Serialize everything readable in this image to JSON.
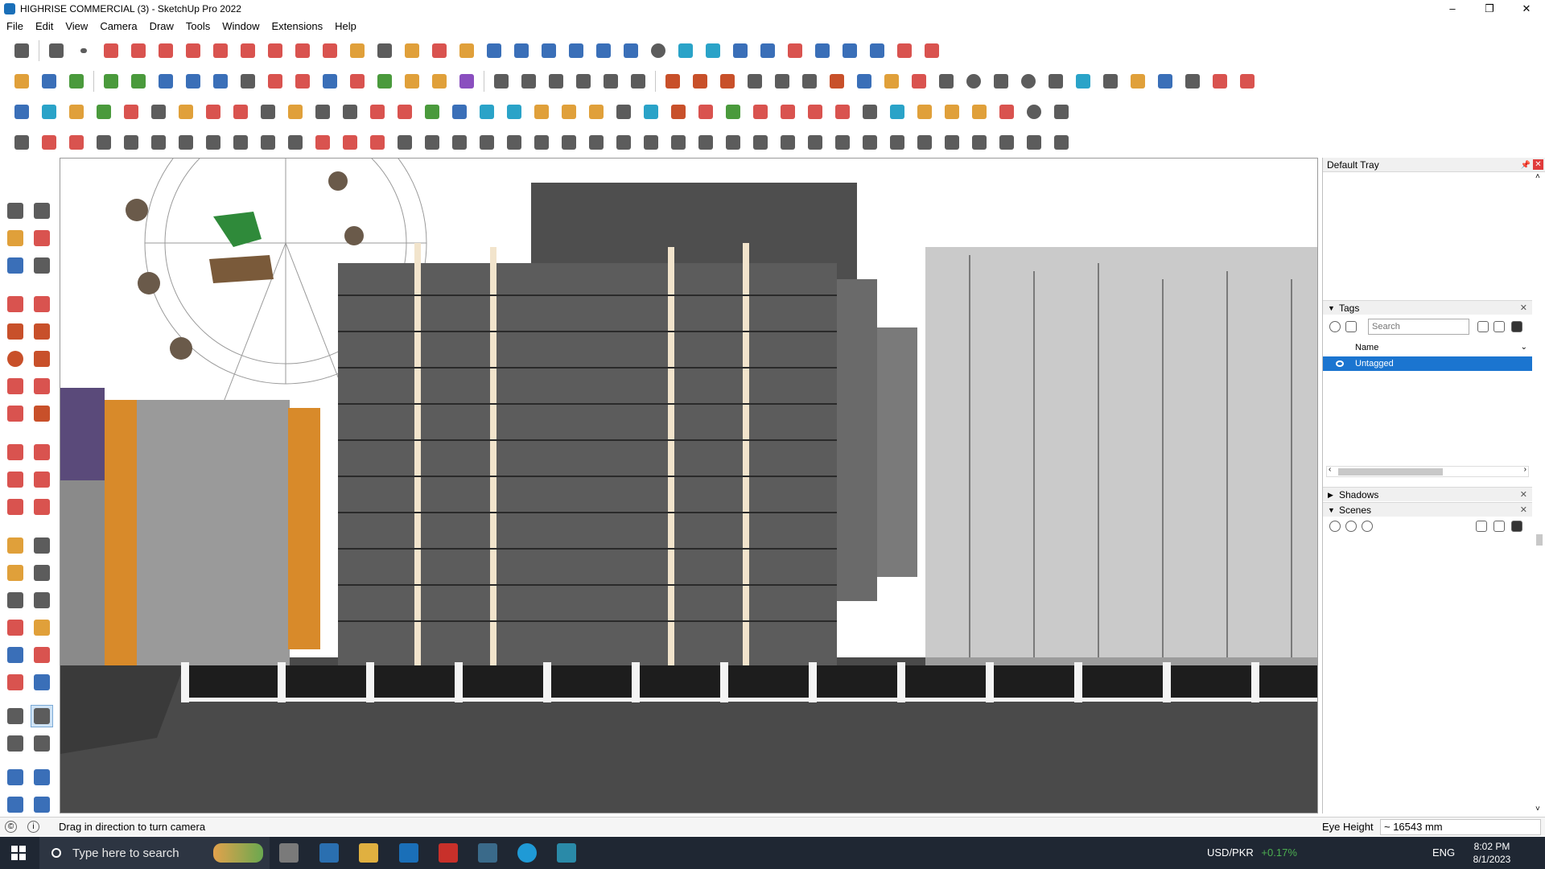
{
  "window": {
    "title": "HIGHRISE COMMERCIAL (3) - SketchUp Pro 2022",
    "buttons": [
      "–",
      "❐",
      "✕"
    ]
  },
  "menu": [
    "File",
    "Edit",
    "View",
    "Camera",
    "Draw",
    "Tools",
    "Window",
    "Extensions",
    "Help"
  ],
  "tray": {
    "title": "Default Tray",
    "tags": {
      "header": "Tags",
      "search_placeholder": "Search",
      "column_name": "Name",
      "rows": [
        "Untagged"
      ]
    },
    "shadows": {
      "header": "Shadows"
    },
    "scenes": {
      "header": "Scenes"
    }
  },
  "statusbar": {
    "hint": "Drag in direction to turn camera",
    "measure_label": "Eye Height",
    "measure_value": "~ 16543 mm"
  },
  "taskbar": {
    "search_placeholder": "Type here to search",
    "currency_label": "USD/PKR",
    "currency_change": "+0.17%",
    "language": "ENG",
    "time": "8:02 PM",
    "date": "8/1/2023"
  },
  "colors": {
    "selection": "#1b75d0",
    "close_red": "#e03c3c",
    "taskbar": "#1f2733"
  }
}
